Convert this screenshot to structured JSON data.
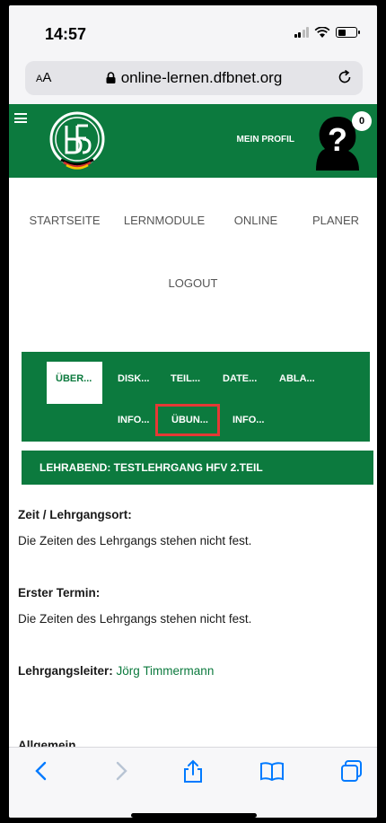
{
  "status_bar": {
    "time": "14:57"
  },
  "browser": {
    "text_size_label": "AA",
    "url": "online-lernen.dfbnet.org"
  },
  "site_header": {
    "profile_label": "MEIN PROFIL",
    "notification_count": "0"
  },
  "nav": {
    "items": [
      {
        "label": "STARTSEITE"
      },
      {
        "label": "LERNMODULE"
      },
      {
        "label": "ONLINE"
      },
      {
        "label": "PLANER"
      },
      {
        "label": "LOGOUT"
      }
    ]
  },
  "tabs": {
    "row1": [
      "ÜBER...",
      "DISK...",
      "TEIL...",
      "DATE...",
      "ABLA..."
    ],
    "row2": [
      "INFO...",
      "ÜBUN...",
      "INFO..."
    ],
    "active": "ÜBER..."
  },
  "course": {
    "banner": "LEHRABEND: TESTLEHRGANG HFV 2.TEIL",
    "time_place_heading": "Zeit / Lehrgangsort:",
    "time_place_text": "Die Zeiten des Lehrgangs stehen nicht fest.",
    "first_date_heading": "Erster Termin:",
    "first_date_text": "Die Zeiten des Lehrgangs stehen nicht fest.",
    "leader_heading": "Lehrgangsleiter:",
    "leader_name": "Jörg Timmermann",
    "general_heading": "Allgemein"
  },
  "colors": {
    "brand_green": "#0c7a3e",
    "highlight_red": "#e53935",
    "ios_blue": "#007aff"
  }
}
